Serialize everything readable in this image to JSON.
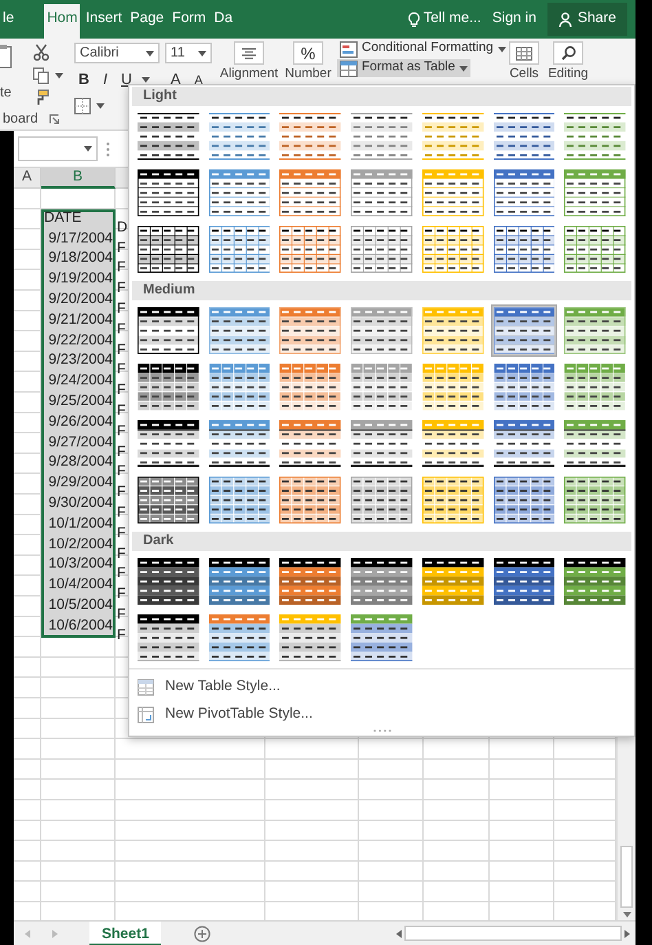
{
  "ribbon": {
    "tabs": [
      {
        "label": "le",
        "selected": false
      },
      {
        "label": "Hom",
        "selected": true
      },
      {
        "label": "Insert",
        "selected": false
      },
      {
        "label": "Page",
        "selected": false
      },
      {
        "label": "Form",
        "selected": false
      },
      {
        "label": "Da",
        "selected": false
      }
    ],
    "tell_me": "Tell me...",
    "sign_in": "Sign in",
    "share": "Share",
    "clipboard": {
      "paste": "te",
      "group_label": "board"
    },
    "font": {
      "name": "Calibri",
      "size": "11",
      "bold": "B",
      "italic": "I",
      "underline": "U",
      "grow": "A",
      "shrink": "A"
    },
    "alignment": "Alignment",
    "number": {
      "symbol": "%",
      "label": "Number"
    },
    "styles": [
      {
        "label": "Conditional Formatting",
        "pressed": false
      },
      {
        "label": "Format as Table",
        "pressed": true
      }
    ],
    "cells": "Cells",
    "editing": "Editing"
  },
  "sheet": {
    "column_headers": [
      {
        "label": "A",
        "selected": false
      },
      {
        "label": "B",
        "selected": true
      }
    ],
    "rows": [
      {
        "column_b": "DATE",
        "column_c": "D",
        "selected": true
      },
      {
        "column_b": "9/17/2004",
        "column_c": "F",
        "selected": true
      },
      {
        "column_b": "9/18/2004",
        "column_c": "F",
        "selected": true
      },
      {
        "column_b": "9/19/2004",
        "column_c": "F",
        "selected": true
      },
      {
        "column_b": "9/20/2004",
        "column_c": "F",
        "selected": true
      },
      {
        "column_b": "9/21/2004",
        "column_c": "F",
        "selected": true
      },
      {
        "column_b": "9/22/2004",
        "column_c": "F",
        "selected": true
      },
      {
        "column_b": "9/23/2004",
        "column_c": "F",
        "selected": true
      },
      {
        "column_b": "9/24/2004",
        "column_c": "F",
        "selected": true
      },
      {
        "column_b": "9/25/2004",
        "column_c": "F",
        "selected": true
      },
      {
        "column_b": "9/26/2004",
        "column_c": "F",
        "selected": true
      },
      {
        "column_b": "9/27/2004",
        "column_c": "F",
        "selected": true
      },
      {
        "column_b": "9/28/2004",
        "column_c": "F",
        "selected": true
      },
      {
        "column_b": "9/29/2004",
        "column_c": "F",
        "selected": true
      },
      {
        "column_b": "9/30/2004",
        "column_c": "F",
        "selected": true
      },
      {
        "column_b": "10/1/2004",
        "column_c": "F",
        "selected": true
      },
      {
        "column_b": "10/2/2004",
        "column_c": "F",
        "selected": true
      },
      {
        "column_b": "10/3/2004",
        "column_c": "F",
        "selected": true
      },
      {
        "column_b": "10/4/2004",
        "column_c": "F",
        "selected": true
      },
      {
        "column_b": "10/5/2004",
        "column_c": "F",
        "selected": true
      },
      {
        "column_b": "10/6/2004",
        "column_c": "F",
        "selected": true
      }
    ],
    "sheet_tabs": [
      {
        "label": "Sheet1",
        "selected": true
      }
    ]
  },
  "gallery": {
    "sections": [
      {
        "title": "Light",
        "rows": [
          {
            "kind": "light-banded",
            "styles": [
              {
                "color": "#000000",
                "selected": false
              },
              {
                "color": "#5b9bd5",
                "selected": false
              },
              {
                "color": "#ed7d31",
                "selected": false
              },
              {
                "color": "#a5a5a5",
                "selected": false
              },
              {
                "color": "#ffc000",
                "selected": false
              },
              {
                "color": "#4472c4",
                "selected": false
              },
              {
                "color": "#70ad47",
                "selected": false
              }
            ]
          },
          {
            "kind": "light-header-bordered",
            "styles": [
              {
                "color": "#000000",
                "selected": false
              },
              {
                "color": "#5b9bd5",
                "selected": false
              },
              {
                "color": "#ed7d31",
                "selected": false
              },
              {
                "color": "#a5a5a5",
                "selected": false
              },
              {
                "color": "#ffc000",
                "selected": false
              },
              {
                "color": "#4472c4",
                "selected": false
              },
              {
                "color": "#70ad47",
                "selected": false
              }
            ]
          },
          {
            "kind": "light-grid",
            "styles": [
              {
                "color": "#000000",
                "selected": false
              },
              {
                "color": "#5b9bd5",
                "selected": false
              },
              {
                "color": "#ed7d31",
                "selected": false
              },
              {
                "color": "#a5a5a5",
                "selected": false
              },
              {
                "color": "#ffc000",
                "selected": false
              },
              {
                "color": "#4472c4",
                "selected": false
              },
              {
                "color": "#70ad47",
                "selected": false
              }
            ]
          }
        ]
      },
      {
        "title": "Medium",
        "rows": [
          {
            "kind": "medium-banded",
            "styles": [
              {
                "color": "#000000",
                "selected": false
              },
              {
                "color": "#5b9bd5",
                "selected": false
              },
              {
                "color": "#ed7d31",
                "selected": false
              },
              {
                "color": "#a5a5a5",
                "selected": false
              },
              {
                "color": "#ffc000",
                "selected": false
              },
              {
                "color": "#4472c4",
                "selected": true
              },
              {
                "color": "#70ad47",
                "selected": false
              }
            ]
          },
          {
            "kind": "medium-columns",
            "styles": [
              {
                "color": "#000000",
                "selected": false
              },
              {
                "color": "#5b9bd5",
                "selected": false
              },
              {
                "color": "#ed7d31",
                "selected": false
              },
              {
                "color": "#a5a5a5",
                "selected": false
              },
              {
                "color": "#ffc000",
                "selected": false
              },
              {
                "color": "#4472c4",
                "selected": false
              },
              {
                "color": "#70ad47",
                "selected": false
              }
            ]
          },
          {
            "kind": "medium-rule",
            "styles": [
              {
                "color": "#000000",
                "selected": false
              },
              {
                "color": "#5b9bd5",
                "selected": false
              },
              {
                "color": "#ed7d31",
                "selected": false
              },
              {
                "color": "#a5a5a5",
                "selected": false
              },
              {
                "color": "#ffc000",
                "selected": false
              },
              {
                "color": "#4472c4",
                "selected": false
              },
              {
                "color": "#70ad47",
                "selected": false
              }
            ]
          },
          {
            "kind": "medium-grid",
            "styles": [
              {
                "color": "#000000",
                "selected": false
              },
              {
                "color": "#5b9bd5",
                "selected": false
              },
              {
                "color": "#ed7d31",
                "selected": false
              },
              {
                "color": "#a5a5a5",
                "selected": false
              },
              {
                "color": "#ffc000",
                "selected": false
              },
              {
                "color": "#4472c4",
                "selected": false
              },
              {
                "color": "#70ad47",
                "selected": false
              }
            ]
          }
        ]
      },
      {
        "title": "Dark",
        "rows": [
          {
            "kind": "dark-banded",
            "styles": [
              {
                "color": "#000000",
                "selected": false
              },
              {
                "color": "#5b9bd5",
                "selected": false
              },
              {
                "color": "#ed7d31",
                "selected": false
              },
              {
                "color": "#a5a5a5",
                "selected": false
              },
              {
                "color": "#ffc000",
                "selected": false
              },
              {
                "color": "#4472c4",
                "selected": false
              },
              {
                "color": "#70ad47",
                "selected": false
              }
            ]
          },
          {
            "kind": "dark-header",
            "styles": [
              {
                "color": "#000000",
                "bands": {
                  "color": "#a5a5a5"
                },
                "selected": false
              },
              {
                "color": "#ed7d31",
                "bands": {
                  "color": "#5b9bd5"
                },
                "selected": false
              },
              {
                "color": "#ffc000",
                "bands": {
                  "color": "#a5a5a5"
                },
                "selected": false
              },
              {
                "color": "#70ad47",
                "bands": {
                  "color": "#4472c4"
                },
                "selected": false
              }
            ]
          }
        ]
      }
    ],
    "commands": [
      {
        "kind": "table",
        "label": "New Table Style..."
      },
      {
        "kind": "pivot",
        "label": "New PivotTable Style..."
      }
    ]
  }
}
